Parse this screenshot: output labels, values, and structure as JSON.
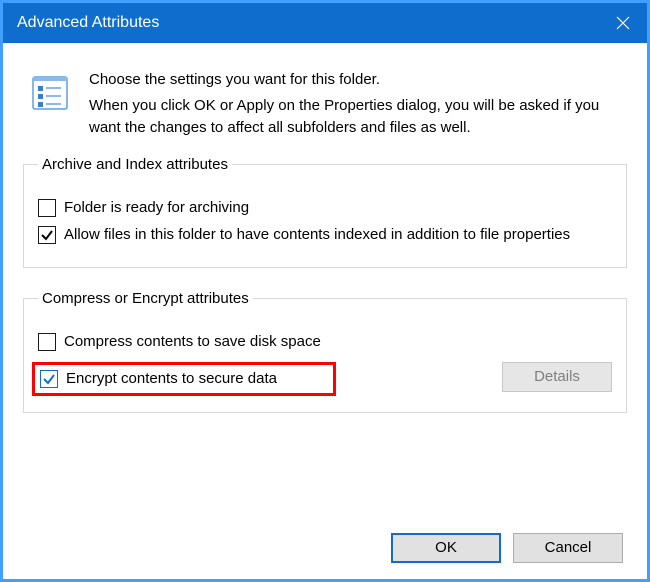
{
  "titlebar": {
    "title": "Advanced Attributes"
  },
  "intro": {
    "main": "Choose the settings you want for this folder.",
    "sub": "When you click OK or Apply on the Properties dialog, you will be asked if you want the changes to affect all subfolders and files as well."
  },
  "group1": {
    "legend": "Archive and Index attributes",
    "opt1": "Folder is ready for archiving",
    "opt2": "Allow files in this folder to have contents indexed in addition to file properties"
  },
  "group2": {
    "legend": "Compress or Encrypt attributes",
    "opt1": "Compress contents to save disk space",
    "opt2": "Encrypt contents to secure data",
    "details": "Details"
  },
  "footer": {
    "ok": "OK",
    "cancel": "Cancel"
  }
}
